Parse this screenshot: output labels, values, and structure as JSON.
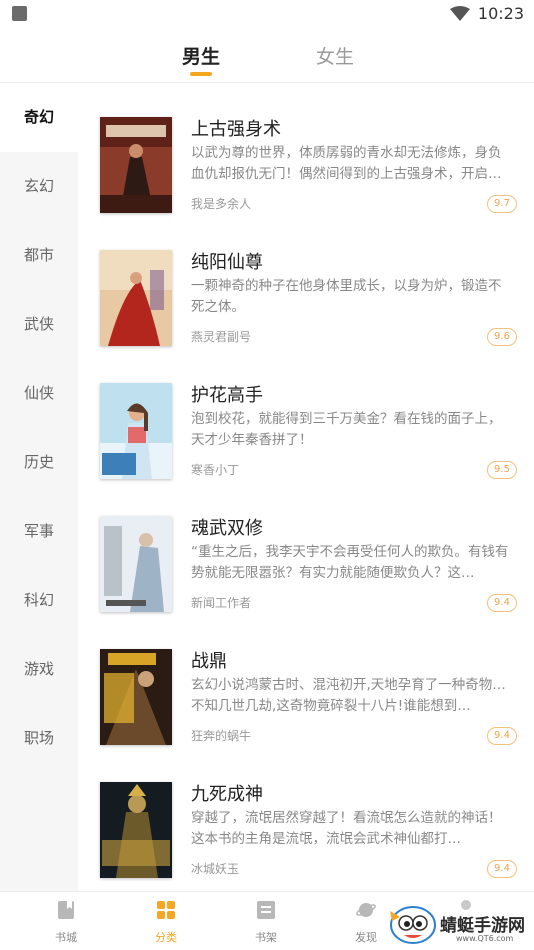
{
  "status": {
    "time": "10:23"
  },
  "gender_tabs": [
    {
      "label": "男生",
      "active": true
    },
    {
      "label": "女生",
      "active": false
    }
  ],
  "categories": [
    "奇幻",
    "玄幻",
    "都市",
    "武侠",
    "仙侠",
    "历史",
    "军事",
    "科幻",
    "游戏",
    "职场"
  ],
  "active_category": "奇幻",
  "books": [
    {
      "title": "上古强身术",
      "desc": "以武为尊的世界，体质孱弱的青水却无法修炼，身负血仇却报仇无门！偶然间得到的上古强身术，开启了一段传奇之路…",
      "author": "我是多余人",
      "score": "9.7"
    },
    {
      "title": "纯阳仙尊",
      "desc": "一颗神奇的种子在他身体里成长，以身为炉，锻造不死之体。",
      "author": "燕灵君副号",
      "score": "9.6"
    },
    {
      "title": "护花高手",
      "desc": "泡到校花，就能得到三千万美金？看在钱的面子上，天才少年秦香拼了！",
      "author": "寒香小丁",
      "score": "9.5"
    },
    {
      "title": "魂武双修",
      "desc": "“重生之后，我李天宇不会再受任何人的欺负。有钱有势就能无限嚣张？有实力就能随便欺负人？这…",
      "author": "新闻工作者",
      "score": "9.4"
    },
    {
      "title": "战鼎",
      "desc": "玄幻小说鸿蒙古时、混沌初开,天地孕育了一种奇物…不知几世几劫,这奇物竟碎裂十八片!谁能想到…",
      "author": "狂奔的蜗牛",
      "score": "9.4"
    },
    {
      "title": "九死成神",
      "desc": "穿越了，流氓居然穿越了！看流氓怎么造就的神话！这本书的主角是流氓，流氓会武术神仙都打…",
      "author": "冰城妖玉",
      "score": "9.4"
    }
  ],
  "tabbar": [
    {
      "label": "书城",
      "icon": "book-icon",
      "active": false
    },
    {
      "label": "分类",
      "icon": "grid-icon",
      "active": true
    },
    {
      "label": "书架",
      "icon": "shelf-icon",
      "active": false
    },
    {
      "label": "发现",
      "icon": "planet-icon",
      "active": false
    },
    {
      "label": "",
      "icon": "profile-icon",
      "active": false
    }
  ],
  "watermark": {
    "title": "蜻蜓手游网",
    "url": "www.QT6.com"
  },
  "colors": {
    "accent": "#f5a623",
    "sidebar_bg": "#f6f6f6",
    "text_muted": "#888888"
  }
}
